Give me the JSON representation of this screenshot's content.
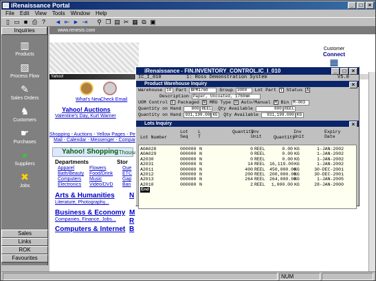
{
  "window": {
    "title": "iRenaissance Portal"
  },
  "menu": [
    "File",
    "Edit",
    "View",
    "Tools",
    "Window",
    "Help"
  ],
  "toolbar": {
    "icons": [
      "new-icon",
      "open-icon",
      "save-icon",
      "print-icon",
      "help-icon",
      "back-icon",
      "back-all-icon",
      "forward-icon",
      "forward-all-icon",
      "binoculars-icon",
      "copy-icon",
      "paste-icon",
      "cut-icon",
      "tile-icon",
      "cascade-icon",
      "calculator-icon"
    ]
  },
  "sidebar": {
    "header": "Inquiries",
    "items": [
      {
        "label": "Products",
        "icon": "products-icon"
      },
      {
        "label": "Process Flow",
        "icon": "process-flow-icon"
      },
      {
        "label": "Sales Orders",
        "icon": "sales-orders-icon"
      },
      {
        "label": "Customers",
        "icon": "customers-icon"
      },
      {
        "label": "Purchases",
        "icon": "purchases-icon"
      },
      {
        "label": "Suppliers",
        "icon": "suppliers-icon"
      },
      {
        "label": "Jobs",
        "icon": "jobs-icon"
      }
    ],
    "bottom": [
      "Sales",
      "Links",
      "ROK",
      "Favourites"
    ]
  },
  "browser": {
    "address": "www.renesis.com",
    "customer_connect": [
      "Customer",
      "Connect"
    ],
    "band_label": "Yahoo!",
    "whats_new": "What's New",
    "check_email": "Check Email",
    "auctions": "Yahoo! Auctions",
    "valentines": "Valentine's Day, Kurt Warner",
    "shopping_line1": "Shopping - Auctions - Yellow Pages - People",
    "shopping_line2": "Mail - Calendar - Messenger - Companion",
    "yshop_title": "Yahoo! Shopping",
    "yshop_tail": "- Thousa",
    "departments_label": "Departments",
    "stores_label": "Stor",
    "departments": [
      [
        "Apparel",
        "Flowers",
        "Oue"
      ],
      [
        "Bath/Beauty",
        "Food/Drink",
        "ETC"
      ],
      [
        "Computers",
        "Music",
        "Gap"
      ],
      [
        "Electronics",
        "Video/DVD",
        "Ban"
      ]
    ],
    "arts_title": "Arts & Humanities",
    "arts_sub": "Literature, Photography...",
    "business_title": "Business & Economy",
    "business_sub": "Companies, Finance, Jobs...",
    "computers_title": "Computers & Internet",
    "side_letters": [
      "N",
      "M",
      "R",
      "B"
    ]
  },
  "inventory": {
    "title": "iRenaissance - FIN.INVENTORY_CONTROL.IC_I_010",
    "program_id": "IC_I_010",
    "system_line": "1: Ross Demonstration System",
    "version": "V5.0",
    "inquiry_title": "Product Warehouse Inquiry",
    "warehouse_label": "Warehouse",
    "warehouse_value": "10",
    "part_label": "Part",
    "part_value": "BPM1760",
    "group_label": "Group",
    "group_value": "3000",
    "lot_part_label": "Lot Part",
    "lot_part_value": "Y",
    "status_label": "Status",
    "status_value": "A",
    "description_label": "Description",
    "description_value": "Paper, Uncoated, 1760mm",
    "uom_label": "UOM Control",
    "uom_value": "E",
    "packaged_label": "Packaged",
    "packaged_value": "N",
    "mru_label": "MRU Type",
    "mru_value": "U",
    "auto_manual_label": "Auto/Manual",
    "auto_manual_value": "M",
    "bin_label": "Bin",
    "bin_value": "M-003",
    "qoh_label": "Quantity on Hand",
    "qoh1_value": "800",
    "qoh1_unit": "REEL",
    "qoh2_value": "931,199.000",
    "qoh2_unit": "KG",
    "qa_label": "Qty Available",
    "qa1_value": "800",
    "qa1_unit": "REEL",
    "qa2_value": "931,199.000",
    "qa2_unit": "KG",
    "lots_title": "Lots Inquiry",
    "lots_headers": {
      "lot_number": "Lot Number",
      "lot_seq": "Lot Seq",
      "lt": "L T",
      "inv_qty": "Quantity",
      "inv_unit": "Inv Unit",
      "quantity": "Quantity",
      "unit": "Inv Unit",
      "expiry": "Expiry Date"
    },
    "lots": [
      [
        "A0A028",
        "000000",
        "N",
        "0",
        "REEL",
        "0.00",
        "KG",
        "1-JAN-2002"
      ],
      [
        "A0A029",
        "000000",
        "N",
        "0",
        "REEL",
        "0.00",
        "KG",
        "1-JAN-2002"
      ],
      [
        "A2030",
        "000000",
        "N",
        "0",
        "REEL",
        "0.00",
        "KG",
        "1-JAN-2002"
      ],
      [
        "A2031",
        "000000",
        "N",
        "14",
        "REEL",
        "16,119.00",
        "KG",
        "1-JAN-2002"
      ],
      [
        "A2011",
        "000000",
        "N",
        "400",
        "REEL",
        "450,000.00",
        "KG",
        "30-DEC-2001"
      ],
      [
        "A2012",
        "000000",
        "N",
        "200",
        "REEL",
        "200,000.00",
        "KG",
        "30-DEC-2001"
      ],
      [
        "A2013",
        "000000",
        "N",
        "264",
        "REEL",
        "264,000.00",
        "KG",
        "1-JAN-2005"
      ],
      [
        "A2010",
        "000000",
        "N",
        "2",
        "REEL",
        "1,000.00",
        "KG",
        "28-JAN-2000"
      ]
    ],
    "end_label": "End"
  },
  "status": {
    "caps": "NUM"
  }
}
